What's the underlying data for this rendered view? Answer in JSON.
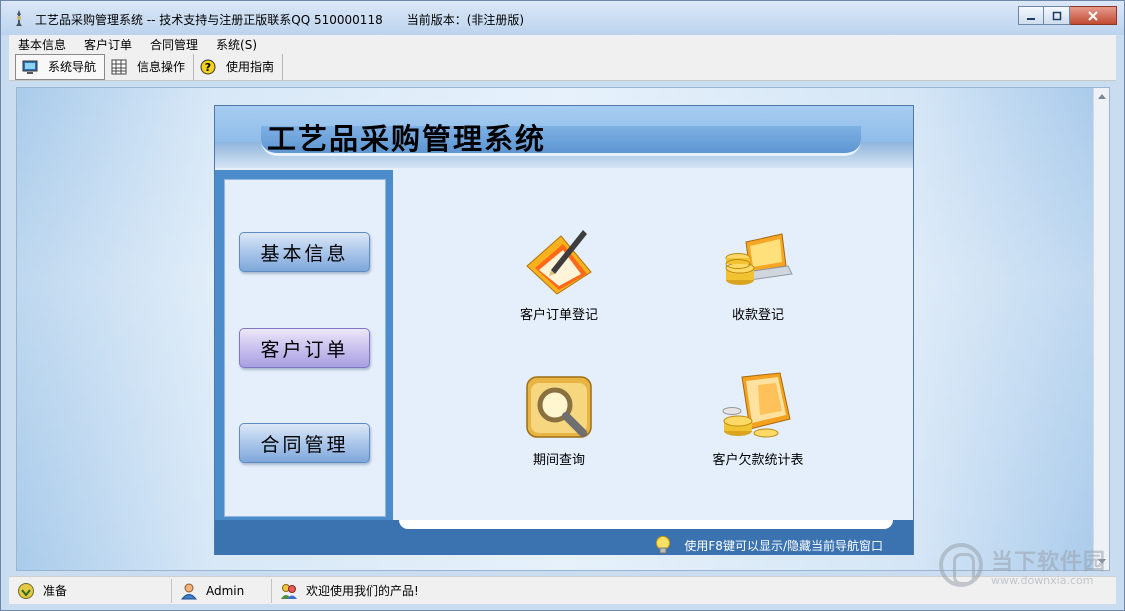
{
  "window": {
    "title": "工艺品采购管理系统 -- 技术支持与注册正版联系QQ 510000118　　当前版本：(非注册版)"
  },
  "menu": [
    "基本信息",
    "客户订单",
    "合同管理",
    "系统(S)"
  ],
  "toolbar": {
    "items": [
      {
        "label": "系统导航",
        "icon": "monitor-icon",
        "active": true
      },
      {
        "label": "信息操作",
        "icon": "grid-icon",
        "active": false
      },
      {
        "label": "使用指南",
        "icon": "help-icon",
        "active": false
      }
    ]
  },
  "nav": {
    "title": "工艺品采购管理系统",
    "side_buttons": [
      {
        "label": "基本信息",
        "selected": false
      },
      {
        "label": "客户订单",
        "selected": true
      },
      {
        "label": "合同管理",
        "selected": false
      }
    ],
    "features": [
      {
        "label": "客户订单登记",
        "icon": "folder-pen-icon"
      },
      {
        "label": "收款登记",
        "icon": "coins-laptop-icon"
      },
      {
        "label": "期间查询",
        "icon": "magnifier-folder-icon"
      },
      {
        "label": "客户欠款统计表",
        "icon": "coins-folder-icon"
      }
    ],
    "footer_hint": "使用F8键可以显示/隐藏当前导航窗口"
  },
  "status": {
    "state": "准备",
    "user": "Admin",
    "message": "欢迎使用我们的产品!"
  },
  "watermark": {
    "text": "当下软件园",
    "url": "www.downxia.com"
  },
  "colors": {
    "accent": "#3b72b0",
    "button_blue": "#7ea7da",
    "button_selected": "#a89fe0"
  }
}
